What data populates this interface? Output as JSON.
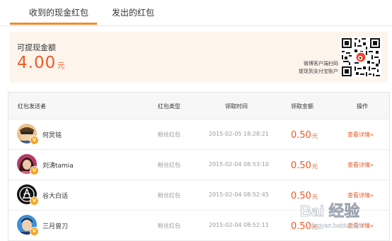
{
  "tabs": [
    {
      "label": "收到的现金红包",
      "active": true
    },
    {
      "label": "发出的红包",
      "active": false
    }
  ],
  "balance": {
    "label": "可提现金额",
    "amount": "4.00",
    "unit": "元",
    "qr_caption_line1": "微博客户端扫码",
    "qr_caption_line2": "提现到支付宝账户"
  },
  "table": {
    "headers": {
      "sender": "红包发送者",
      "type": "红包类型",
      "time": "领取时间",
      "amount": "领取金额",
      "action": "操作"
    },
    "rows": [
      {
        "name": "何炅铭",
        "type": "粉丝红包",
        "time": "2015-02-05 18:28:21",
        "amount": "0.50",
        "unit": "元",
        "action": "查看详情»",
        "badge": "V",
        "avatar": "portrait-sunglasses"
      },
      {
        "name": "刘涛tamia",
        "type": "粉丝红包",
        "time": "2015-02-04 08:53:10",
        "amount": "0.50",
        "unit": "元",
        "action": "查看详情»",
        "badge": "V",
        "avatar": "portrait-woman"
      },
      {
        "name": "谷大白话",
        "type": "粉丝红包",
        "time": "2015-02-04 08:52:45",
        "amount": "0.50",
        "unit": "元",
        "action": "查看详情»",
        "badge": "V",
        "avatar": "black-emblem"
      },
      {
        "name": "三月曾刀",
        "type": "粉丝红包",
        "time": "2015-02-04 08:52:11",
        "amount": "0.50",
        "unit": "元",
        "action": "查看详情»",
        "badge": "V",
        "avatar": "portrait-blue"
      }
    ]
  },
  "watermark": {
    "text": "Bai 经验",
    "subtext": "jingyan.baidu.com"
  },
  "colors": {
    "accent": "#f08a2c",
    "amount": "#f05a24",
    "panel_bg": "#fdf4ec",
    "badge": "#f5a623"
  }
}
